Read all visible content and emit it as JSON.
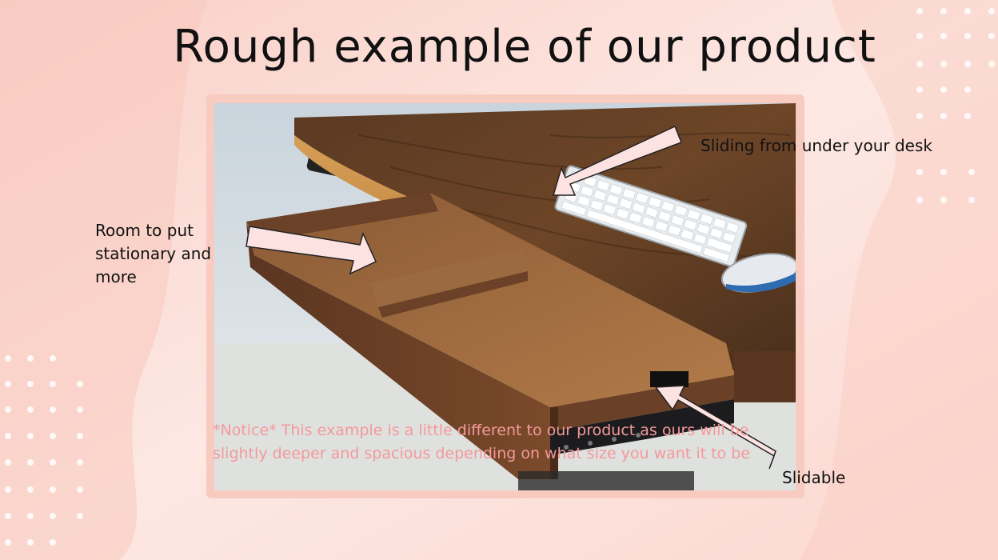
{
  "slide": {
    "title": "Rough example of our product",
    "photo_description_icon": "desk-drawer-photo",
    "labels": {
      "room": "Room to put stationary and more",
      "sliding": "Sliding from under your desk",
      "slidable": "Slidable"
    },
    "notice": "*Notice* This example is a little different to our product as ours will be slightly deeper and spacious depending on what size you want it to be"
  },
  "colors": {
    "background": "#fdece8",
    "frame": "#f8cbc1",
    "arrow_fill": "#fde2e2",
    "notice_text": "#f4999a"
  }
}
